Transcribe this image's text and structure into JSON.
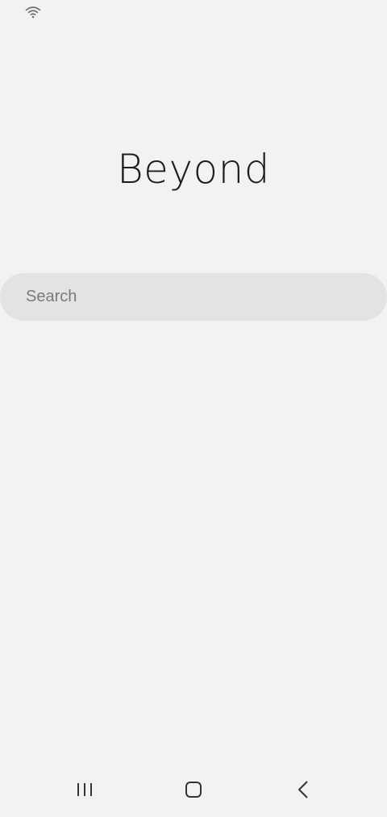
{
  "status_bar": {
    "icons": [
      "wifi-icon"
    ]
  },
  "header": {
    "title": "Beyond"
  },
  "search": {
    "placeholder": "Search",
    "value": ""
  },
  "nav_bar": {
    "buttons": [
      {
        "name": "recents",
        "icon": "recents-icon"
      },
      {
        "name": "home",
        "icon": "home-icon"
      },
      {
        "name": "back",
        "icon": "back-icon"
      }
    ]
  },
  "colors": {
    "background": "#f2f2f2",
    "search_background": "#e3e3e3",
    "title_text": "#1e1e1e",
    "placeholder_text": "#7a7a7a",
    "nav_icon": "#333333"
  }
}
